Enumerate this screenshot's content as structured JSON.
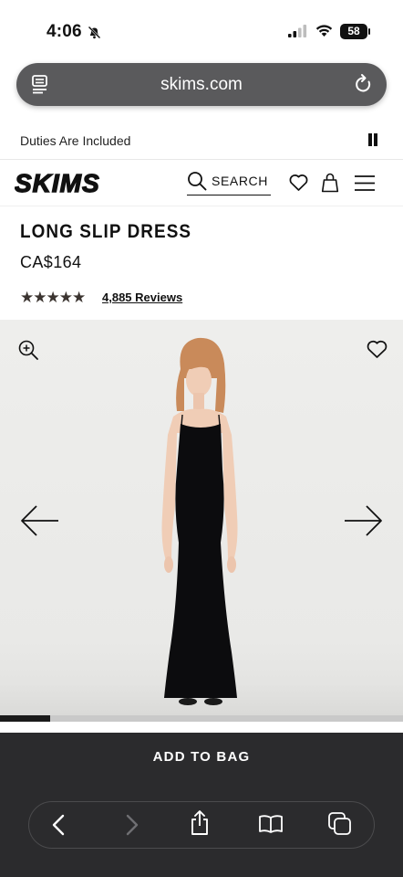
{
  "status_bar": {
    "time": "4:06",
    "battery": "58",
    "icons": [
      "bell-slash-icon",
      "cellular-signal-icon",
      "wifi-icon",
      "battery-icon"
    ]
  },
  "browser": {
    "url": "skims.com",
    "icons": [
      "reader-icon",
      "reload-icon"
    ]
  },
  "announcement": {
    "text": "Duties Are Included",
    "icon": "pause-icon"
  },
  "header": {
    "logo": "SKIMS",
    "search_label": "SEARCH",
    "icons": [
      "search-icon",
      "heart-icon",
      "bag-icon",
      "menu-icon"
    ]
  },
  "product": {
    "name": "LONG SLIP DRESS",
    "price": "CA$164",
    "stars": "★★★★★",
    "rating": 5,
    "reviews": "4,885 Reviews"
  },
  "gallery": {
    "icons": [
      "zoom-in-icon",
      "heart-icon",
      "arrow-left-icon",
      "arrow-right-icon"
    ],
    "progress": 0.125,
    "colors": {
      "background": "#ecece9",
      "dress": "#0c0c0e"
    }
  },
  "cta": {
    "label": "ADD TO BAG",
    "background": "#2b2b2d"
  },
  "toolbar": {
    "icons": [
      "chevron-left-icon",
      "chevron-right-icon",
      "share-icon",
      "bookmarks-icon",
      "tabs-icon"
    ]
  }
}
